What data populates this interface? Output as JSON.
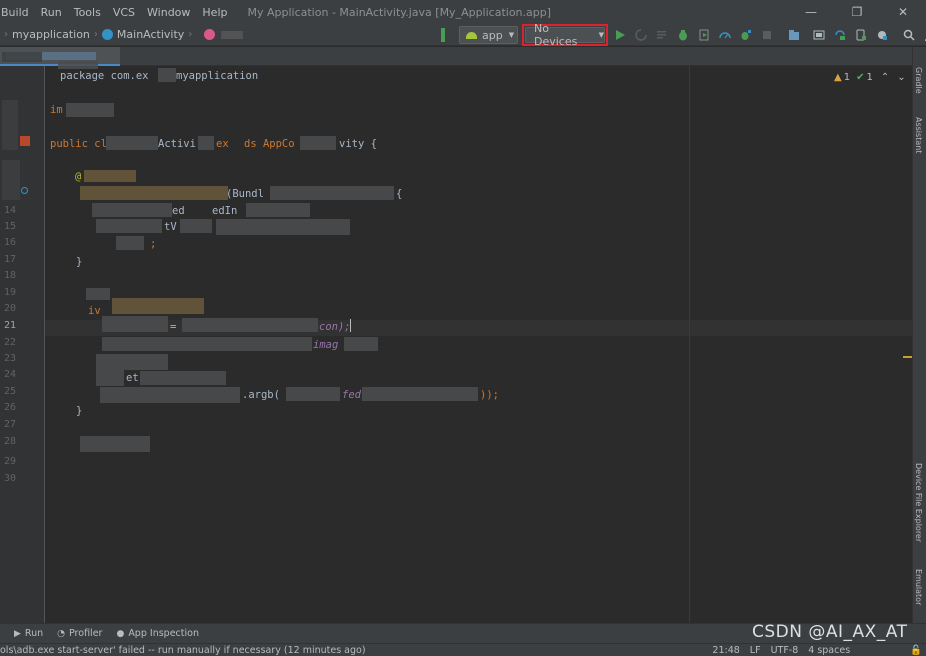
{
  "menu": {
    "items": [
      "Build",
      "Run",
      "Tools",
      "VCS",
      "Window",
      "Help"
    ],
    "window_title": "My Application - MainActivity.java [My_Application.app]"
  },
  "window_controls": [
    "—",
    "❐",
    "✕"
  ],
  "breadcrumb": {
    "project": "myapplication",
    "class": "MainActivity"
  },
  "toolbar": {
    "run_config": "app",
    "device_selector": "No Devices"
  },
  "editor": {
    "line_numbers": [
      "14",
      "15",
      "16",
      "17",
      "18",
      "19",
      "20",
      "21",
      "22",
      "23",
      "24",
      "25",
      "26",
      "27",
      "28",
      "29",
      "30"
    ],
    "code_fragments": {
      "package_line": "package com.ex",
      "package_tail": "myapplication",
      "import_kw": "im",
      "class_decl_a": "public cl",
      "class_decl_b": "Activi",
      "class_decl_c": "ex",
      "class_decl_d": "ds AppCo",
      "class_decl_e": "vity {",
      "annotation": "@",
      "bundle": "(Bundl",
      "ed_in": "ed",
      "ed_in2": "edIn",
      "tv": "tV",
      "semicolon": ";",
      "brace_close": "}",
      "iv": "iv",
      "eq": "=",
      "con": "con);",
      "imag": "imag",
      "et": "et",
      "argb": ".argb(",
      "fed": "fed",
      "argb_tail": "));",
      "final_brace": "}"
    },
    "inspection": {
      "warnings": "1",
      "weak_warnings": "1"
    }
  },
  "right_tools": [
    "Gradle",
    "Assistant",
    "Device File Explorer",
    "Emulator"
  ],
  "bottom_tools": [
    "Run",
    "Profiler",
    "App Inspection"
  ],
  "watermark": "CSDN @AI_AX_AT",
  "status": {
    "message": "ols\\adb.exe start-server' failed -- run manually if necessary (12 minutes ago)",
    "position": "21:48",
    "line_sep": "LF",
    "encoding": "UTF-8",
    "indent": "4 spaces"
  },
  "colors": {
    "background": "#2b2b2b",
    "chrome": "#3c3f41",
    "highlight_border": "#d9232e",
    "keyword": "#cc7832",
    "annotation": "#bbb529"
  }
}
